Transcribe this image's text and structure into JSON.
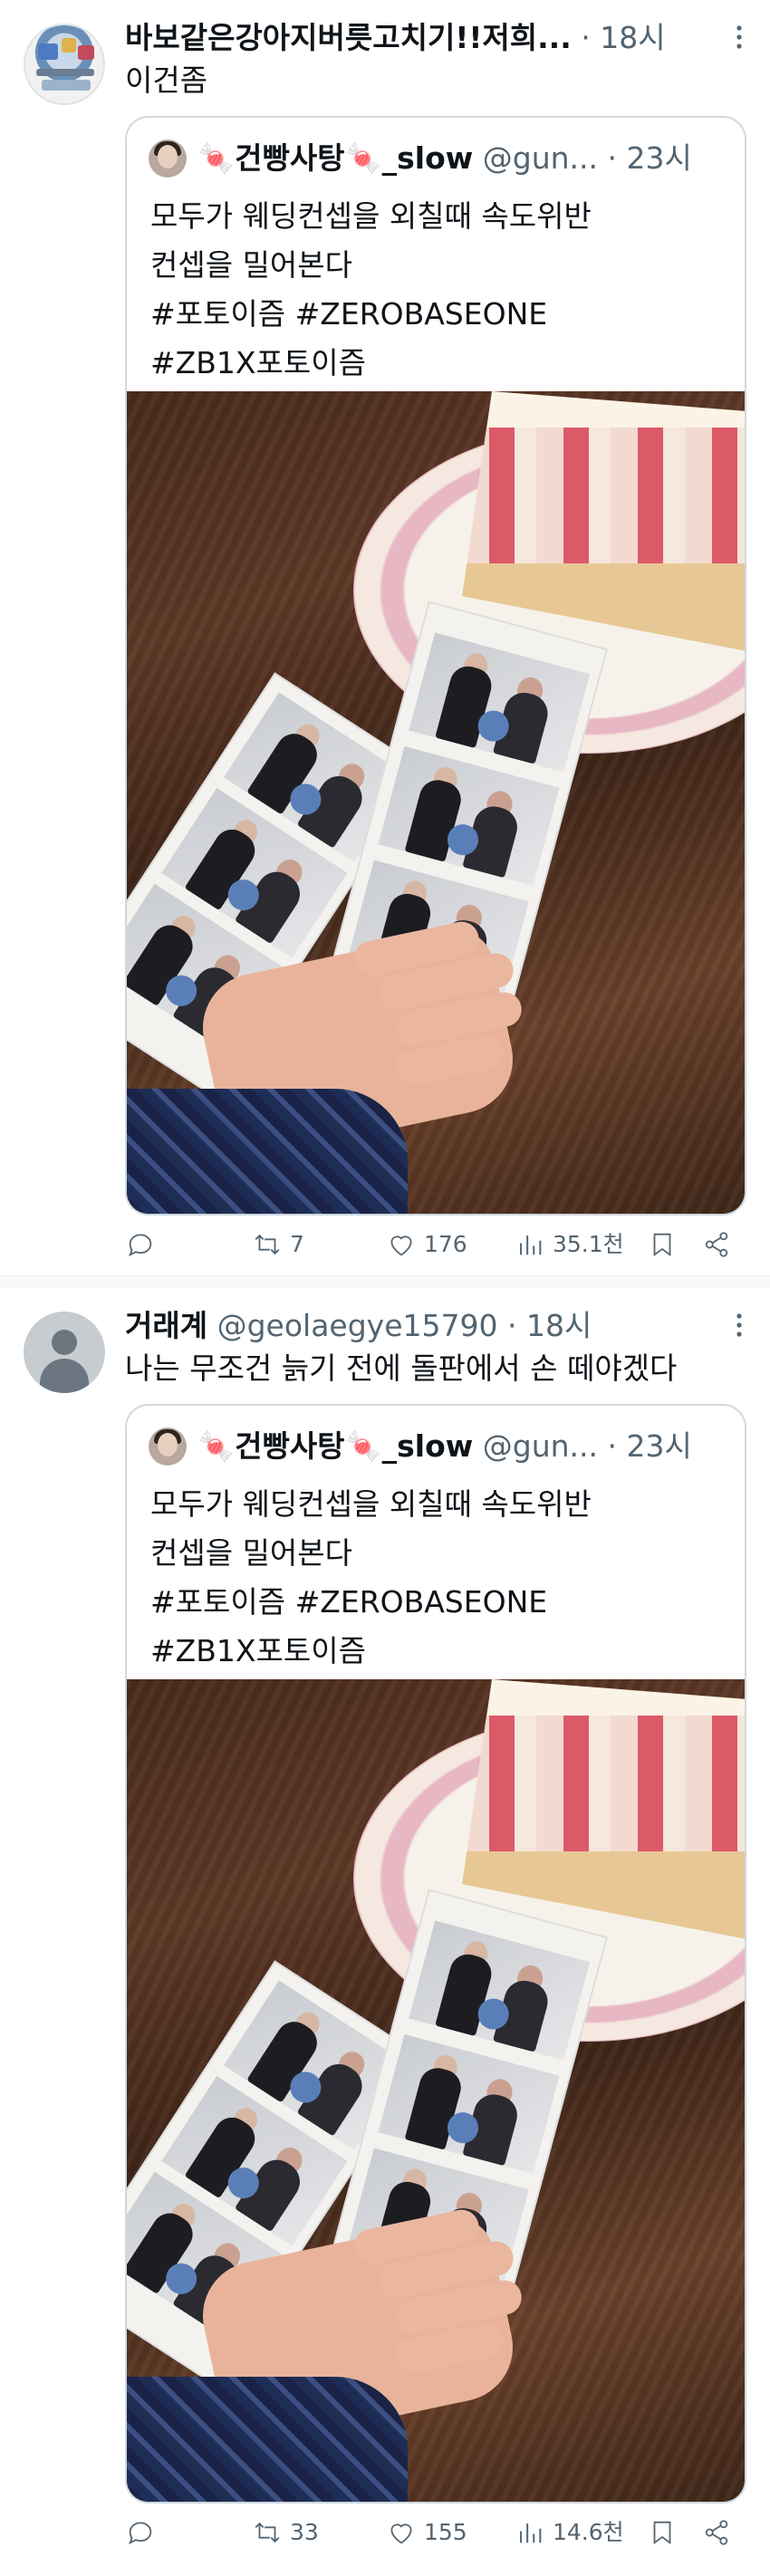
{
  "posts": [
    {
      "author_name": "바보같은강아지버릇고치기!!저희...",
      "author_handle": "",
      "separator": "·",
      "time": "18시",
      "text": "이건좀",
      "quote": {
        "candy_left": "🍬",
        "author_name": "건빵사탕",
        "candy_right": "🍬",
        "author_suffix": "_slow",
        "author_handle": "@gun...",
        "separator": "·",
        "time": "23시",
        "lines": [
          "모두가 웨딩컨셉을 외칠때 속도위반",
          "컨셉을 밀어본다",
          "#포토이즘 #ZEROBASEONE",
          "#ZB1X포토이즘"
        ]
      },
      "actions": {
        "replies": "",
        "reposts": "7",
        "likes": "176",
        "views": "35.1천"
      }
    },
    {
      "author_name": "거래계",
      "author_handle": "@geolaegye15790",
      "separator": "·",
      "time": "18시",
      "text": "나는 무조건 늙기 전에 돌판에서 손 떼야겠다",
      "quote": {
        "candy_left": "🍬",
        "author_name": "건빵사탕",
        "candy_right": "🍬",
        "author_suffix": "_slow",
        "author_handle": "@gun...",
        "separator": "·",
        "time": "23시",
        "lines": [
          "모두가 웨딩컨셉을 외칠때 속도위반",
          "컨셉을 밀어본다",
          "#포토이즘 #ZEROBASEONE",
          "#ZB1X포토이즘"
        ]
      },
      "actions": {
        "replies": "",
        "reposts": "33",
        "likes": "155",
        "views": "14.6천"
      }
    }
  ],
  "icons": {
    "reply": "reply-icon",
    "repost": "repost-icon",
    "like": "heart-icon",
    "views": "views-chart-icon",
    "bookmark": "bookmark-icon",
    "share": "share-icon",
    "more": "more-icon"
  },
  "colors": {
    "text": "#0f1419",
    "secondary": "#536471",
    "border": "#cfd9de",
    "candy": "#e0245e"
  }
}
